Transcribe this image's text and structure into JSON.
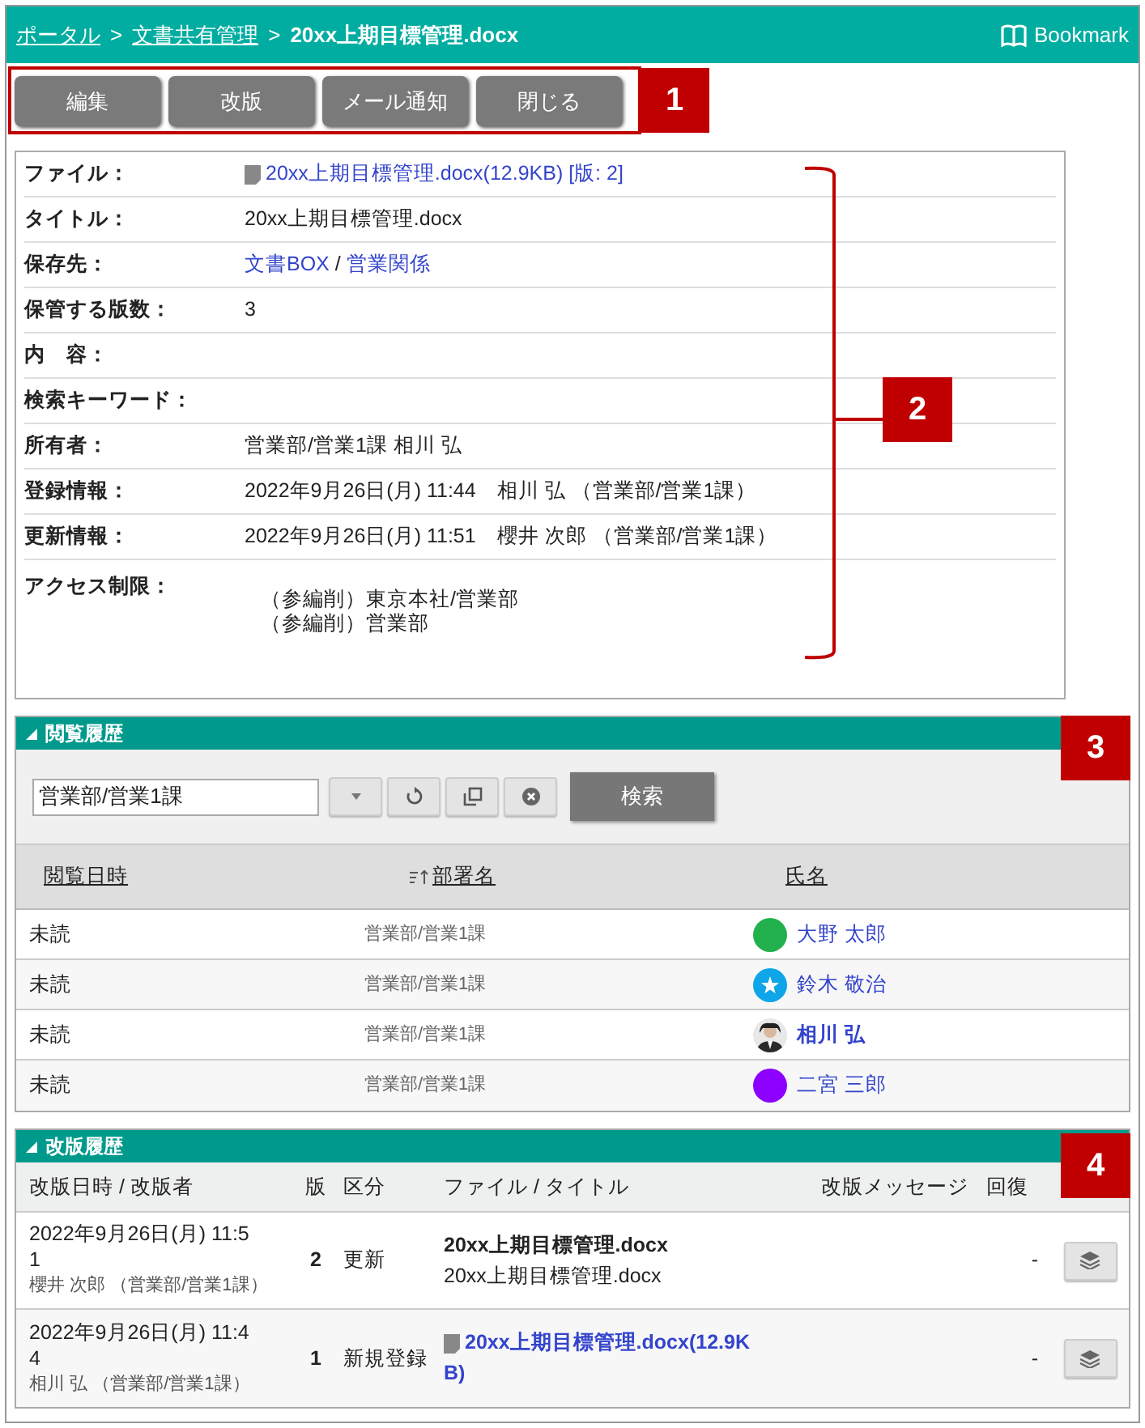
{
  "breadcrumb": [
    {
      "label": "ポータル",
      "link": true
    },
    {
      "separator": ">",
      "label": "文書共有管理",
      "link": true
    },
    {
      "separator": ">",
      "label": "20xx上期目標管理.docx",
      "link": false
    }
  ],
  "bookmark": "Bookmark",
  "toolbar": [
    "編集",
    "改版",
    "メール通知",
    "閉じる"
  ],
  "details": [
    {
      "label": "ファイル：",
      "kind": "file",
      "value": "20xx上期目標管理.docx(12.9KB) [版: 2]"
    },
    {
      "label": "タイトル：",
      "kind": "text",
      "value": "20xx上期目標管理.docx"
    },
    {
      "label": "保存先：",
      "kind": "path",
      "links": [
        "文書BOX",
        "営業関係"
      ],
      "separator": "/"
    },
    {
      "label": "保管する版数：",
      "kind": "text",
      "value": "3"
    },
    {
      "label": "内　容：",
      "kind": "text"
    },
    {
      "label": "検索キーワード：",
      "kind": "text"
    },
    {
      "label": "所有者：",
      "kind": "text",
      "value": "営業部/営業1課 相川 弘"
    },
    {
      "label": "登録情報：",
      "kind": "text",
      "value": "2022年9月26日(月) 11:44　相川 弘 （営業部/営業1課）"
    },
    {
      "label": "更新情報：",
      "kind": "text",
      "value": "2022年9月26日(月) 11:51　櫻井 次郎 （営業部/営業1課）"
    },
    {
      "label": "アクセス制限：",
      "kind": "list",
      "lines": [
        "（参編削）東京本社/営業部",
        "（参編削）営業部"
      ]
    }
  ],
  "view_history": {
    "title": "閲覧履歴",
    "expanded": true,
    "filter": {
      "value": "営業部/営業1課"
    },
    "search_button": "検索",
    "columns": [
      {
        "label": "閲覧日時",
        "sorted": false
      },
      {
        "label": "部署名",
        "sorted": true
      },
      {
        "label": "氏名",
        "sorted": false
      }
    ],
    "rows": [
      {
        "status": "未読",
        "department": "営業部/営業1課",
        "name": "大野 太郎",
        "kind": "dot",
        "color": "#22b14c",
        "bold": false
      },
      {
        "status": "未読",
        "department": "営業部/営業1課",
        "name": "鈴木 敬治",
        "kind": "star",
        "color": "#0ea5e9",
        "bold": false
      },
      {
        "status": "未読",
        "department": "営業部/営業1課",
        "name": "相川 弘",
        "bold": true
      },
      {
        "status": "未読",
        "department": "営業部/営業1課",
        "name": "二宮 三郎",
        "kind": "dot",
        "color": "#8b00ff",
        "bold": false
      }
    ]
  },
  "revision_history": {
    "title": "改版履歴",
    "expanded": true,
    "columns": [
      "改版日時 / 改版者",
      "版",
      "区分",
      "ファイル / タイトル",
      "改版メッセージ",
      "回復"
    ],
    "rows": [
      {
        "date": "2022年9月26日(月) 11:51",
        "user": "櫻井 次郎 （営業部/営業1課）",
        "version": "2",
        "type": "更新",
        "kind": "title",
        "file": "20xx上期目標管理.docx",
        "title": "20xx上期目標管理.docx",
        "restore": "-"
      },
      {
        "date": "2022年9月26日(月) 11:44",
        "user": "相川 弘 （営業部/営業1課）",
        "version": "1",
        "type": "新規登録",
        "kind": "link",
        "file": "20xx上期目標管理.docx(12.9KB)",
        "restore": "-"
      }
    ]
  },
  "callouts": [
    "1",
    "2",
    "3",
    "4"
  ]
}
